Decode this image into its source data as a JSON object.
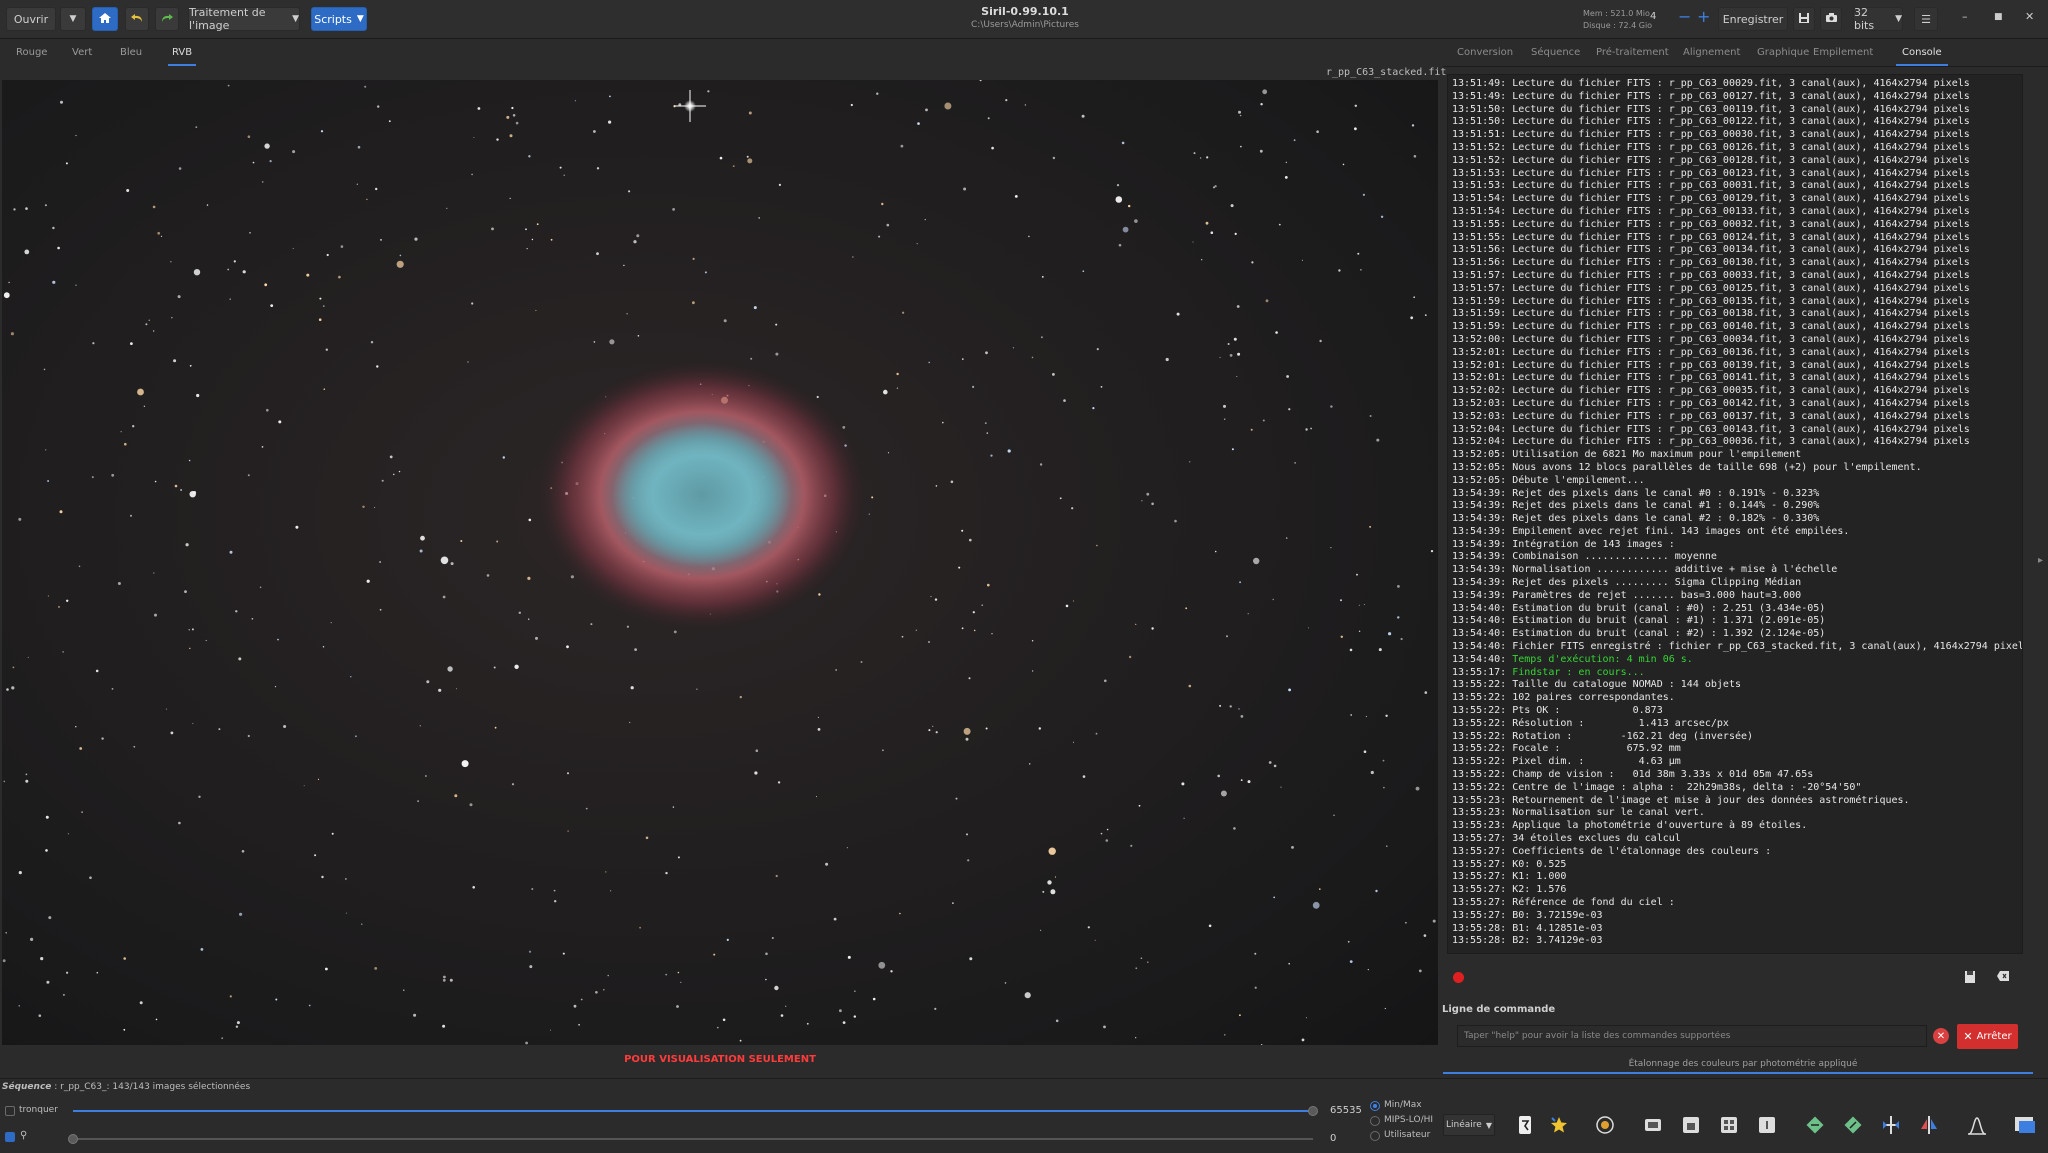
{
  "app": {
    "title": "Siril-0.99.10.1",
    "path": "C:\\Users\\Admin\\Pictures",
    "mem": "Mem : 521.0 Mio",
    "disk": "Disque : 72.4 Gio"
  },
  "toolbar": {
    "open_label": "Ouvrir",
    "processing_label": "Traitement de l'image",
    "scripts_label": "Scripts",
    "threads_value": "4",
    "save_label": "Enregistrer",
    "bits_label": "32 bits"
  },
  "channel_tabs": [
    "Rouge",
    "Vert",
    "Bleu",
    "RVB"
  ],
  "image": {
    "filename": "r_pp_C63_stacked.fit",
    "viz_only": "POUR VISUALISATION SEULEMENT"
  },
  "right_tabs": [
    "Conversion",
    "Séquence",
    "Pré-traitement",
    "Alignement",
    "Graphique",
    "Empilement",
    "Console"
  ],
  "console": {
    "lines": [
      {
        "t": "13:51:49:",
        "m": "Lecture du fichier FITS : r_pp_C63_00029.fit, 3 canal(aux), 4164x2794 pixels"
      },
      {
        "t": "13:51:49:",
        "m": "Lecture du fichier FITS : r_pp_C63_00127.fit, 3 canal(aux), 4164x2794 pixels"
      },
      {
        "t": "13:51:50:",
        "m": "Lecture du fichier FITS : r_pp_C63_00119.fit, 3 canal(aux), 4164x2794 pixels"
      },
      {
        "t": "13:51:50:",
        "m": "Lecture du fichier FITS : r_pp_C63_00122.fit, 3 canal(aux), 4164x2794 pixels"
      },
      {
        "t": "13:51:51:",
        "m": "Lecture du fichier FITS : r_pp_C63_00030.fit, 3 canal(aux), 4164x2794 pixels"
      },
      {
        "t": "13:51:52:",
        "m": "Lecture du fichier FITS : r_pp_C63_00126.fit, 3 canal(aux), 4164x2794 pixels"
      },
      {
        "t": "13:51:52:",
        "m": "Lecture du fichier FITS : r_pp_C63_00128.fit, 3 canal(aux), 4164x2794 pixels"
      },
      {
        "t": "13:51:53:",
        "m": "Lecture du fichier FITS : r_pp_C63_00123.fit, 3 canal(aux), 4164x2794 pixels"
      },
      {
        "t": "13:51:53:",
        "m": "Lecture du fichier FITS : r_pp_C63_00031.fit, 3 canal(aux), 4164x2794 pixels"
      },
      {
        "t": "13:51:54:",
        "m": "Lecture du fichier FITS : r_pp_C63_00129.fit, 3 canal(aux), 4164x2794 pixels"
      },
      {
        "t": "13:51:54:",
        "m": "Lecture du fichier FITS : r_pp_C63_00133.fit, 3 canal(aux), 4164x2794 pixels"
      },
      {
        "t": "13:51:55:",
        "m": "Lecture du fichier FITS : r_pp_C63_00032.fit, 3 canal(aux), 4164x2794 pixels"
      },
      {
        "t": "13:51:55:",
        "m": "Lecture du fichier FITS : r_pp_C63_00124.fit, 3 canal(aux), 4164x2794 pixels"
      },
      {
        "t": "13:51:56:",
        "m": "Lecture du fichier FITS : r_pp_C63_00134.fit, 3 canal(aux), 4164x2794 pixels"
      },
      {
        "t": "13:51:56:",
        "m": "Lecture du fichier FITS : r_pp_C63_00130.fit, 3 canal(aux), 4164x2794 pixels"
      },
      {
        "t": "13:51:57:",
        "m": "Lecture du fichier FITS : r_pp_C63_00033.fit, 3 canal(aux), 4164x2794 pixels"
      },
      {
        "t": "13:51:57:",
        "m": "Lecture du fichier FITS : r_pp_C63_00125.fit, 3 canal(aux), 4164x2794 pixels"
      },
      {
        "t": "13:51:59:",
        "m": "Lecture du fichier FITS : r_pp_C63_00135.fit, 3 canal(aux), 4164x2794 pixels"
      },
      {
        "t": "13:51:59:",
        "m": "Lecture du fichier FITS : r_pp_C63_00138.fit, 3 canal(aux), 4164x2794 pixels"
      },
      {
        "t": "13:51:59:",
        "m": "Lecture du fichier FITS : r_pp_C63_00140.fit, 3 canal(aux), 4164x2794 pixels"
      },
      {
        "t": "13:52:00:",
        "m": "Lecture du fichier FITS : r_pp_C63_00034.fit, 3 canal(aux), 4164x2794 pixels"
      },
      {
        "t": "13:52:01:",
        "m": "Lecture du fichier FITS : r_pp_C63_00136.fit, 3 canal(aux), 4164x2794 pixels"
      },
      {
        "t": "13:52:01:",
        "m": "Lecture du fichier FITS : r_pp_C63_00139.fit, 3 canal(aux), 4164x2794 pixels"
      },
      {
        "t": "13:52:01:",
        "m": "Lecture du fichier FITS : r_pp_C63_00141.fit, 3 canal(aux), 4164x2794 pixels"
      },
      {
        "t": "13:52:02:",
        "m": "Lecture du fichier FITS : r_pp_C63_00035.fit, 3 canal(aux), 4164x2794 pixels"
      },
      {
        "t": "13:52:03:",
        "m": "Lecture du fichier FITS : r_pp_C63_00142.fit, 3 canal(aux), 4164x2794 pixels"
      },
      {
        "t": "13:52:03:",
        "m": "Lecture du fichier FITS : r_pp_C63_00137.fit, 3 canal(aux), 4164x2794 pixels"
      },
      {
        "t": "13:52:04:",
        "m": "Lecture du fichier FITS : r_pp_C63_00143.fit, 3 canal(aux), 4164x2794 pixels"
      },
      {
        "t": "13:52:04:",
        "m": "Lecture du fichier FITS : r_pp_C63_00036.fit, 3 canal(aux), 4164x2794 pixels"
      },
      {
        "t": "13:52:05:",
        "m": "Utilisation de 6821 Mo maximum pour l'empilement"
      },
      {
        "t": "13:52:05:",
        "m": "Nous avons 12 blocs parallèles de taille 698 (+2) pour l'empilement."
      },
      {
        "t": "13:52:05:",
        "m": "Débute l'empilement..."
      },
      {
        "t": "13:54:39:",
        "m": "Rejet des pixels dans le canal #0 : 0.191% - 0.323%"
      },
      {
        "t": "13:54:39:",
        "m": "Rejet des pixels dans le canal #1 : 0.144% - 0.290%"
      },
      {
        "t": "13:54:39:",
        "m": "Rejet des pixels dans le canal #2 : 0.182% - 0.330%"
      },
      {
        "t": "13:54:39:",
        "m": "Empilement avec rejet fini. 143 images ont été empilées."
      },
      {
        "t": "13:54:39:",
        "m": "Intégration de 143 images :"
      },
      {
        "t": "13:54:39:",
        "m": "Combinaison .............. moyenne"
      },
      {
        "t": "13:54:39:",
        "m": "Normalisation ............ additive + mise à l'échelle"
      },
      {
        "t": "13:54:39:",
        "m": "Rejet des pixels ......... Sigma Clipping Médian"
      },
      {
        "t": "13:54:39:",
        "m": "Paramètres de rejet ....... bas=3.000 haut=3.000"
      },
      {
        "t": "13:54:40:",
        "m": "Estimation du bruit (canal : #0) : 2.251 (3.434e-05)"
      },
      {
        "t": "13:54:40:",
        "m": "Estimation du bruit (canal : #1) : 1.371 (2.091e-05)"
      },
      {
        "t": "13:54:40:",
        "m": "Estimation du bruit (canal : #2) : 1.392 (2.124e-05)"
      },
      {
        "t": "13:54:40:",
        "m": "Fichier FITS enregistré : fichier r_pp_C63_stacked.fit, 3 canal(aux), 4164x2794 pixels"
      },
      {
        "t": "13:54:40:",
        "m": "Temps d'exécution: 4 min 06 s.",
        "green": true
      },
      {
        "t": "13:55:17:",
        "m": "Findstar : en cours...",
        "green": true
      },
      {
        "t": "13:55:22:",
        "m": "Taille du catalogue NOMAD : 144 objets"
      },
      {
        "t": "13:55:22:",
        "m": "102 paires correspondantes."
      },
      {
        "t": "13:55:22:",
        "m": "Pts OK :            0.873"
      },
      {
        "t": "13:55:22:",
        "m": "Résolution :         1.413 arcsec/px"
      },
      {
        "t": "13:55:22:",
        "m": "Rotation :        -162.21 deg (inversée)"
      },
      {
        "t": "13:55:22:",
        "m": "Focale :           675.92 mm"
      },
      {
        "t": "13:55:22:",
        "m": "Pixel dim. :         4.63 µm"
      },
      {
        "t": "13:55:22:",
        "m": "Champ de vision :   01d 38m 3.33s x 01d 05m 47.65s"
      },
      {
        "t": "13:55:22:",
        "m": "Centre de l'image : alpha :  22h29m38s, delta : -20°54'50\""
      },
      {
        "t": "13:55:23:",
        "m": "Retournement de l'image et mise à jour des données astrométriques."
      },
      {
        "t": "13:55:23:",
        "m": "Normalisation sur le canal vert."
      },
      {
        "t": "13:55:23:",
        "m": "Applique la photométrie d'ouverture à 89 étoiles."
      },
      {
        "t": "13:55:27:",
        "m": "34 étoiles exclues du calcul"
      },
      {
        "t": "13:55:27:",
        "m": "Coefficients de l'étalonnage des couleurs :"
      },
      {
        "t": "13:55:27:",
        "m": "K0: 0.525"
      },
      {
        "t": "13:55:27:",
        "m": "K1: 1.000"
      },
      {
        "t": "13:55:27:",
        "m": "K2: 1.576"
      },
      {
        "t": "13:55:27:",
        "m": "Référence de fond du ciel :"
      },
      {
        "t": "13:55:27:",
        "m": "B0: 3.72159e-03"
      },
      {
        "t": "13:55:28:",
        "m": "B1: 4.12851e-03"
      },
      {
        "t": "13:55:28:",
        "m": "B2: 3.74129e-03"
      }
    ]
  },
  "command": {
    "label": "Ligne de commande",
    "placeholder": "Taper \"help\" pour avoir la liste des commandes supportées",
    "stop_label": "Arrêter",
    "status": "Étalonnage des couleurs par photométrie appliqué"
  },
  "bottom": {
    "sequence_label": "Séquence",
    "sequence_info": " : r_pp_C63_: 143/143 images sélectionnées",
    "clip_label": "tronquer",
    "max_value": "65535",
    "min_value": "0",
    "mode_options": [
      "Min/Max",
      "MIPS-LO/HI",
      "Utilisateur"
    ],
    "mode_selected": "Min/Max",
    "stretch_label": "Linéaire"
  },
  "colors": {
    "accent": "#3d7fe0",
    "stop": "#d42f2f",
    "console_green": "#35d435",
    "warning_red": "#ff3b3b"
  }
}
